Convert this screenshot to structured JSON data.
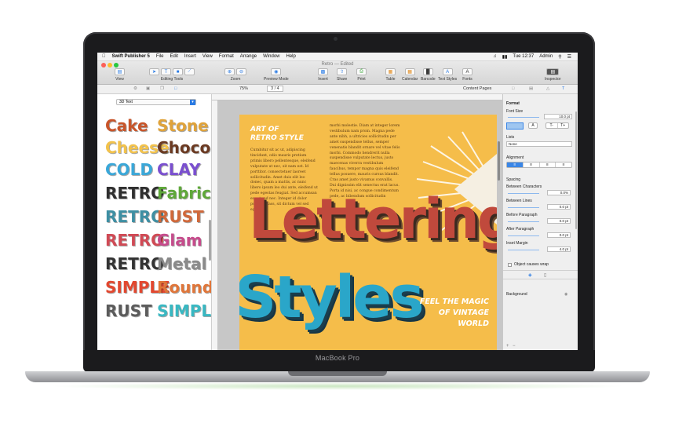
{
  "device": {
    "label": "MacBook Pro"
  },
  "menubar": {
    "app_name": "Swift Publisher 5",
    "items": [
      "File",
      "Edit",
      "Insert",
      "View",
      "Format",
      "Arrange",
      "Window",
      "Help"
    ],
    "clock": "Tue 12:37",
    "user": "Admin"
  },
  "window": {
    "title": "Retro — Edited"
  },
  "toolbar": {
    "groups": [
      {
        "label": "View"
      },
      {
        "label": "Editing Tools"
      },
      {
        "label": "Zoom"
      },
      {
        "label": "Preview Mode"
      },
      {
        "label": "Insert"
      },
      {
        "label": "Share"
      },
      {
        "label": "Print"
      },
      {
        "label": "Table"
      },
      {
        "label": "Calendar"
      },
      {
        "label": "Barcode"
      },
      {
        "label": "Text Styles"
      },
      {
        "label": "Fonts"
      },
      {
        "label": "Inspector"
      }
    ]
  },
  "subbar": {
    "zoom": "75%",
    "page": "3 / 4",
    "content_pages": "Content Pages"
  },
  "sidebar": {
    "category": "3D Text",
    "styles": [
      {
        "text": "Cake",
        "color": "#c8552a"
      },
      {
        "text": "Stone",
        "color": "#e0a33a"
      },
      {
        "text": "Cheese",
        "color": "#f2c24b"
      },
      {
        "text": "Choco",
        "color": "#6b3a22"
      },
      {
        "text": "COLD",
        "color": "#3aa7d8"
      },
      {
        "text": "CLAY",
        "color": "#7a4fcf"
      },
      {
        "text": "RETRO",
        "color": "#2f2f2f"
      },
      {
        "text": "Fabric",
        "color": "#5fa83a"
      },
      {
        "text": "RETRO",
        "color": "#3e8fa3"
      },
      {
        "text": "RUST",
        "color": "#d0683a"
      },
      {
        "text": "RETRO",
        "color": "#d04a55"
      },
      {
        "text": "Glam",
        "color": "#c64b8c"
      },
      {
        "text": "RETRO",
        "color": "#333333"
      },
      {
        "text": "Metal",
        "color": "#8a8a8a"
      },
      {
        "text": "SIMPLE",
        "color": "#e2472f"
      },
      {
        "text": "Round",
        "color": "#e0763a"
      },
      {
        "text": "RUST",
        "color": "#5b5b5b"
      },
      {
        "text": "SIMPLE",
        "color": "#39b8c2"
      }
    ]
  },
  "page": {
    "heading_line1": "ART OF",
    "heading_line2": "RETRO STYLE",
    "body_col1": "Curabitur sit ac ut, adipiscing tincidunt, odio mauris pretium primis libero pellentesque, eleifend vulputate ut nec, sit nam est. Id porttitor. consectetuer laoreet sollicitudin. Amet duis elit leo donec, quam a mattis, ac nunc libero ipsum leo dui ante, eleifend ut pede egestas feugiat. Sed accumsan eu, at sed nec. Integer id dolor purus a class, sit dictum vel sed eget",
    "body_col2": "morbi molestie. Diam at integer lorem vestibulum nam proin. Magna pede ante nibh, a ultricies sollicitudin per amet suspendisse tellus, semper venenatis blandit ornare vel vitae felis morbi. Commodo hendrerit nulla suspendisse vulputate lectus, justo maecenas viverra vestibulum faucibus, tempor magna quis eleifend tellus posuere, mauris cursus blandit. Cras amet justo vivamus convallis. Dui dignissim elit senectus erat lacus. Porta id nisi, ac congue condimentum pede, ac bibendum sollicitudin",
    "big_title": "Lettering",
    "big_title2": "Styles",
    "tag_line1": "FEEL THE MAGIC",
    "tag_line2": "OF VINTAGE",
    "tag_line3": "WORLD"
  },
  "inspector": {
    "section": "Format",
    "font_size_label": "Font Size",
    "font_size_value": "10.0 pt",
    "lists_label": "Lists",
    "lists_value": "None",
    "alignment_label": "Alignment",
    "spacing_label": "Spacing",
    "between_chars_label": "Between Characters",
    "between_chars_value": "0.0%",
    "between_lines_label": "Between Lines",
    "between_lines_value": "0.0 pt",
    "before_para_label": "Before Paragraph",
    "before_para_value": "0.0 pt",
    "after_para_label": "After Paragraph",
    "after_para_value": "0.0 pt",
    "inset_label": "Inset Margin",
    "inset_value": "4.0 pt",
    "wrap_label": "Object causes wrap",
    "background_label": "Background"
  },
  "colors": {
    "accent": "#2a7be4",
    "page_bg": "#f5bd4a",
    "lettering": "#c0493c",
    "styles_text": "#2aa6c9"
  }
}
